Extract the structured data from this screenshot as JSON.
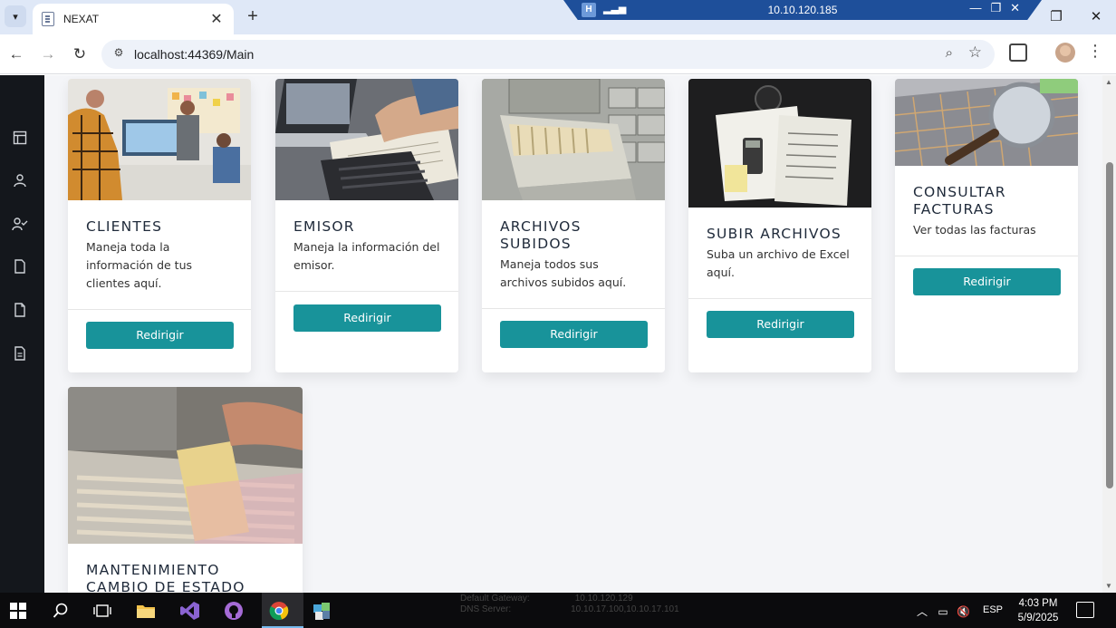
{
  "browser": {
    "tab_title": "NEXAT",
    "tab_close": "✕",
    "new_tab": "+",
    "url": "localhost:44369/Main",
    "rdp_host": "10.10.120.185"
  },
  "nav": {
    "back": "←",
    "forward": "→",
    "reload": "↻"
  },
  "cards": [
    {
      "title": "CLIENTES",
      "text": "Maneja toda la información de tus clientes aquí.",
      "button": "Redirigir"
    },
    {
      "title": "EMISOR",
      "text": "Maneja la información del emisor.",
      "button": "Redirigir"
    },
    {
      "title": "ARCHIVOS SUBIDOS",
      "text": "Maneja todos sus archivos subidos aquí.",
      "button": "Redirigir"
    },
    {
      "title": "SUBIR ARCHIVOS",
      "text": "Suba un archivo de Excel aquí.",
      "button": "Redirigir"
    },
    {
      "title": "CONSULTAR FACTURAS",
      "text": "Ver todas las facturas",
      "button": "Redirigir"
    },
    {
      "title": "MANTENIMIENTO CAMBIO DE ESTADO",
      "text": "",
      "button": ""
    }
  ],
  "sidebar": {
    "icons": [
      "layout-icon",
      "user-icon",
      "user-check-icon",
      "file-icon",
      "file-2-icon",
      "file-text-icon"
    ]
  },
  "taskbar": {
    "net_gateway_label": "Default Gateway:",
    "net_gateway_value": "10.10.120.129",
    "net_dns_label": "DNS Server:",
    "net_dns_value": "10.10.17.100,10.10.17.101",
    "language": "ESP",
    "time": "4:03 PM",
    "date": "5/9/2025"
  },
  "colors": {
    "accent": "#18939a",
    "sidebar": "#14171c",
    "taskbar": "#0b0b0d"
  }
}
